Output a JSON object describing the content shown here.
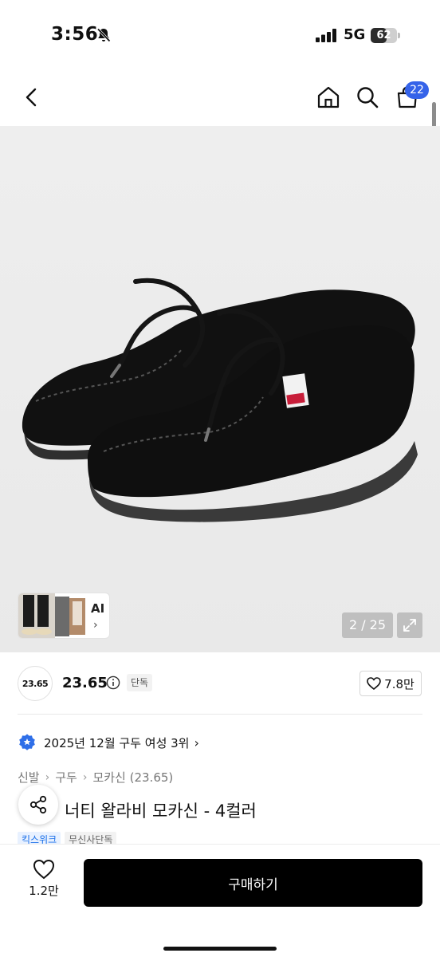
{
  "status_bar": {
    "time": "3:56",
    "network": "5G",
    "battery_level": "62",
    "battery_fraction": 0.62
  },
  "nav": {
    "cart_count": "22",
    "icons": [
      "back-icon",
      "home-icon",
      "search-icon",
      "cart-icon"
    ]
  },
  "hero": {
    "page_counter": "2 / 25",
    "ai_label": "AI",
    "ai_chevron": "›",
    "background_color": "#ececec"
  },
  "product": {
    "brand_logo_text": "23.65",
    "brand_name": "23.65",
    "exclusive_label": "단독",
    "like_count": "7.8만",
    "ranking_text": "2025년 12월 구두 여성 3위",
    "ranking_chevron": "›",
    "breadcrumb": [
      "신발",
      "구두",
      "모카신 (23.65)"
    ],
    "breadcrumb_separator": "›",
    "title": "너티 왈라비 모카신 - 4컬러",
    "tags": [
      "킥스위크",
      "무신사단독"
    ]
  },
  "bottom_bar": {
    "like_count": "1.2만",
    "buy_label": "구매하기"
  },
  "colors": {
    "accent_blue": "#3563e9",
    "tag_blue": "#1a6fe8",
    "buy_button": "#000000"
  }
}
